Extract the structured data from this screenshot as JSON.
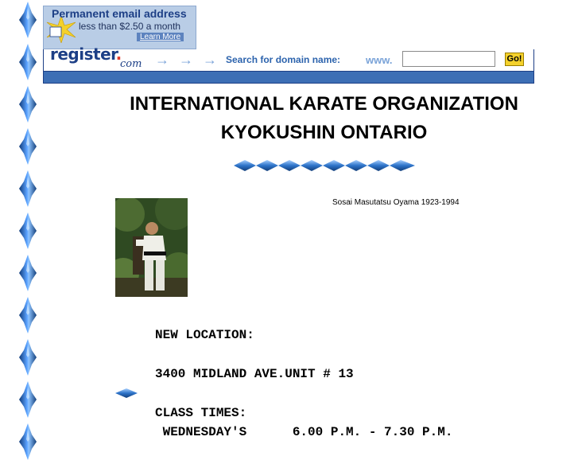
{
  "banner": {
    "ad_title": "Permanent email address",
    "ad_subtitle": "less than $2.50 a month",
    "ad_link": "Learn More",
    "logo_main": "register",
    "logo_dot": ".",
    "logo_com": "com",
    "arrows": "→→→",
    "search_label": "Search for domain name:",
    "www_label": "www.",
    "domain_input_value": "",
    "go_label": "Go!"
  },
  "page": {
    "title_line1": "INTERNATIONAL KARATE ORGANIZATION",
    "title_line2": "KYOKUSHIN ONTARIO",
    "photo_caption": "Sosai Masutatsu Oyama 1923-1994",
    "location_heading": "NEW LOCATION:",
    "address": "3400 MIDLAND AVE.UNIT # 13",
    "class_times_heading": "CLASS TIMES:",
    "schedule_line": " WEDNESDAY'S      6.00 P.M. - 7.30 P.M."
  },
  "colors": {
    "ornament_blue": "#2d73c9",
    "banner_blue": "#1d3f86",
    "go_yellow": "#f4d12b"
  },
  "icons": {
    "side_ornament": "blue-diamond-ornament-icon",
    "divider": "blue-diamond-row-icon",
    "bullet": "blue-diamond-bullet-icon",
    "ad_star": "starburst-icon"
  }
}
